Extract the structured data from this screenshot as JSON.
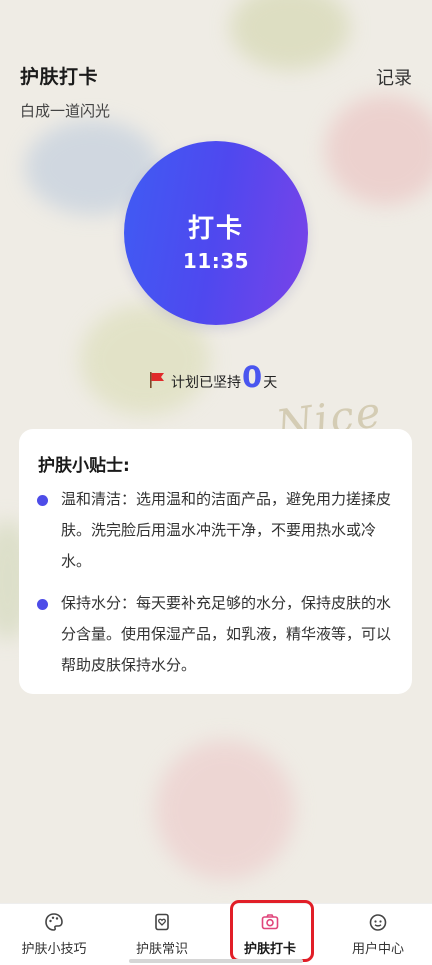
{
  "header": {
    "title": "护肤打卡",
    "record_label": "记录"
  },
  "subtitle": "白成一道闪光",
  "checkin": {
    "label": "打卡",
    "time": "11:35"
  },
  "streak": {
    "prefix": "计划已坚持",
    "count": "0",
    "suffix": "天"
  },
  "decoration_text": "Nice",
  "tips": {
    "title": "护肤小贴士:",
    "items": [
      {
        "text": "温和清洁：选用温和的洁面产品，避免用力搓揉皮肤。洗完脸后用温水冲洗干净，不要用热水或冷水。"
      },
      {
        "text": "保持水分：每天要补充足够的水分，保持皮肤的水分含量。使用保湿产品，如乳液，精华液等，可以帮助皮肤保持水分。"
      }
    ]
  },
  "tabbar": {
    "items": [
      {
        "label": "护肤小技巧",
        "icon": "palette-icon"
      },
      {
        "label": "护肤常识",
        "icon": "heart-card-icon"
      },
      {
        "label": "护肤打卡",
        "icon": "camera-icon"
      },
      {
        "label": "用户中心",
        "icon": "smiley-face-icon"
      }
    ],
    "active_index": 2
  },
  "colors": {
    "accent": "#4a56ef",
    "gradient_start": "#3f5cf4",
    "gradient_end": "#7a43e8",
    "active_tab_icon": "#e0457b",
    "highlight": "#e11e27",
    "flag": "#e02a2a"
  }
}
